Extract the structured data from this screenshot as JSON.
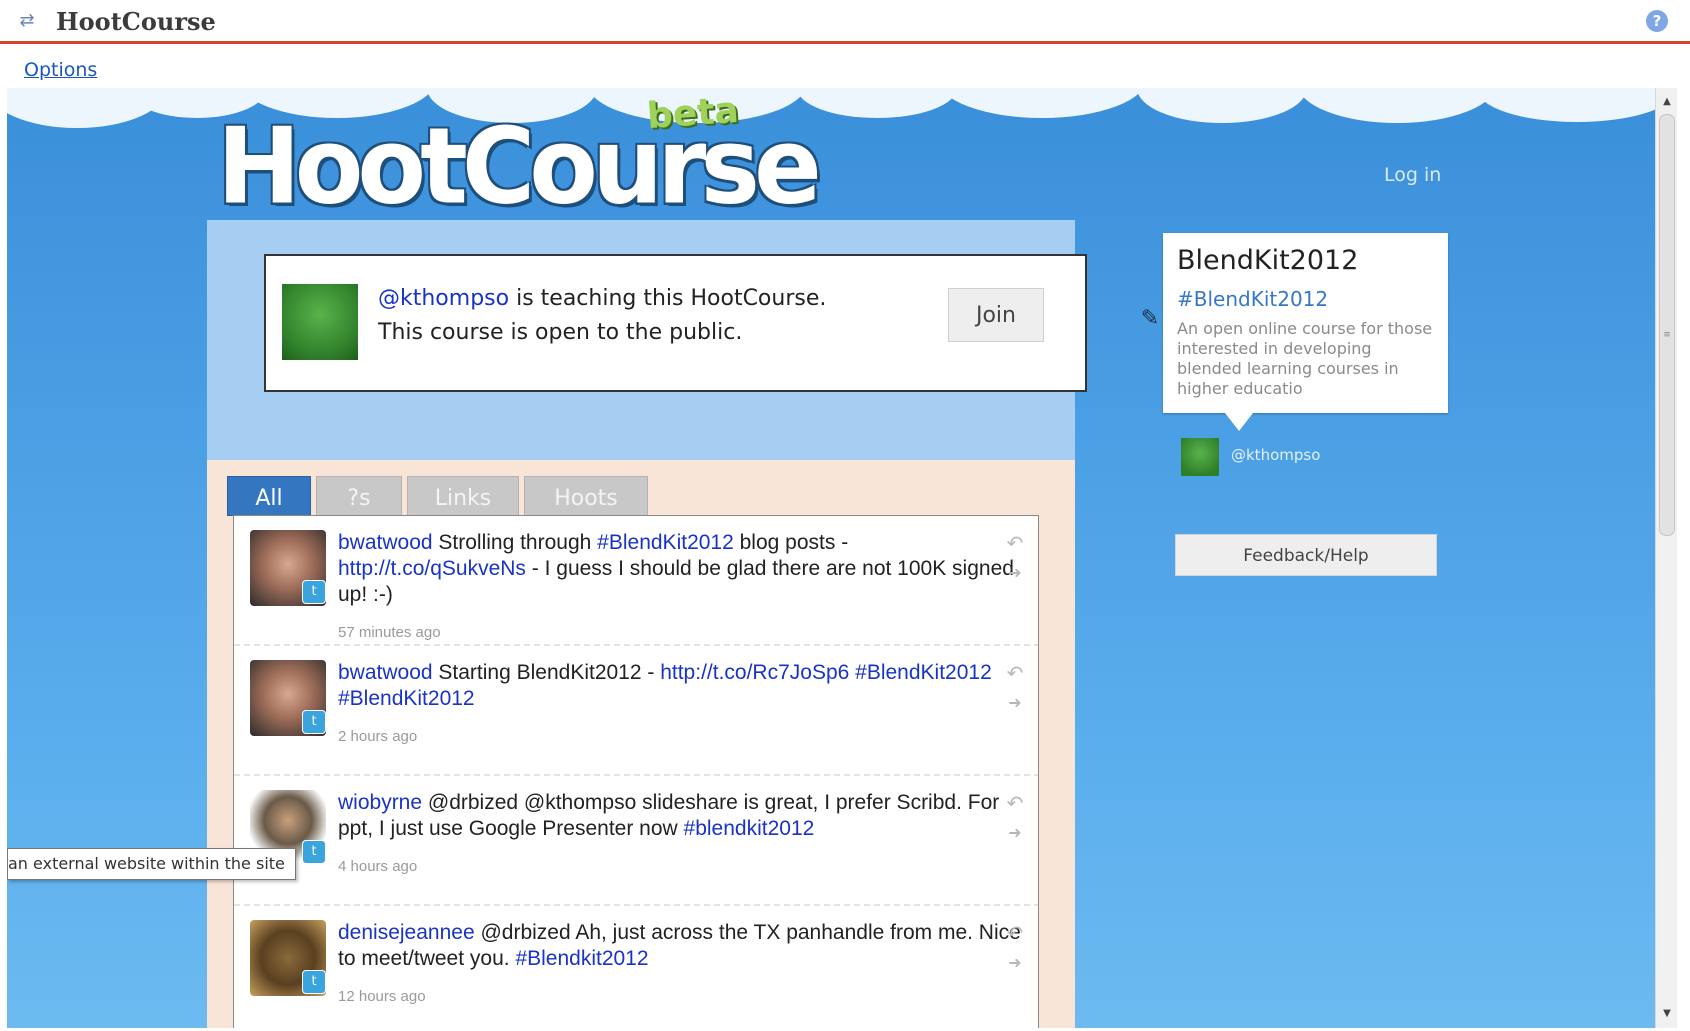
{
  "window": {
    "title": "HootCourse",
    "menu": {
      "options": "Options"
    }
  },
  "site": {
    "logo_text": "HootCourse",
    "logo_badge": "beta",
    "login": "Log in"
  },
  "teacher": {
    "handle": "@kthompso",
    "line1_suffix": " is teaching this HootCourse.",
    "line2": "This course is open to the public.",
    "join_label": "Join"
  },
  "tabs": [
    {
      "label": "All",
      "active": true
    },
    {
      "label": "?s",
      "active": false
    },
    {
      "label": "Links",
      "active": false
    },
    {
      "label": "Hoots",
      "active": false
    }
  ],
  "tweets": [
    {
      "user": "bwatwood",
      "time": "57 minutes ago",
      "parts": [
        {
          "t": "bwatwood",
          "link": true
        },
        {
          "t": " Strolling through ",
          "link": false
        },
        {
          "t": "#BlendKit2012",
          "link": true
        },
        {
          "t": " blog posts - ",
          "link": false
        },
        {
          "t": "http://t.co/qSukveNs",
          "link": true
        },
        {
          "t": " - I guess I should be glad there are not 100K signed up! :-)",
          "link": false
        }
      ]
    },
    {
      "user": "bwatwood",
      "time": "2 hours ago",
      "parts": [
        {
          "t": "bwatwood",
          "link": true
        },
        {
          "t": " Starting BlendKit2012 - ",
          "link": false
        },
        {
          "t": "http://t.co/Rc7JoSp6",
          "link": true
        },
        {
          "t": " ",
          "link": false
        },
        {
          "t": "#BlendKit2012",
          "link": true
        },
        {
          "t": " ",
          "link": false
        },
        {
          "t": "#BlendKit2012",
          "link": true
        }
      ]
    },
    {
      "user": "wiobyrne",
      "time": "4 hours ago",
      "parts": [
        {
          "t": "wiobyrne",
          "link": true
        },
        {
          "t": " @drbized @kthompso slideshare is great, I prefer Scribd. For ppt, I just use Google Presenter now ",
          "link": false
        },
        {
          "t": "#blendkit2012",
          "link": true
        }
      ]
    },
    {
      "user": "denisejeannee",
      "time": "12 hours ago",
      "parts": [
        {
          "t": "denisejeannee",
          "link": true
        },
        {
          "t": " @drbized Ah, just across the TX panhandle from me. Nice to meet/tweet you. ",
          "link": false
        },
        {
          "t": "#Blendkit2012",
          "link": true
        }
      ]
    }
  ],
  "course": {
    "title": "BlendKit2012",
    "hashtag": "#BlendKit2012",
    "description": "An open online course for those interested in developing blended learning courses in higher educatio",
    "owner": "@kthompso",
    "feedback": "Feedback/Help"
  },
  "tooltip": "an external website within the site",
  "icons": {
    "app": "arrows-icon",
    "help": "help-icon",
    "reply": "reply-icon",
    "retweet": "retweet-icon",
    "twitter": "twitter-icon",
    "edit": "pencil-icon"
  },
  "colors": {
    "accent_red": "#d0442a",
    "link_blue": "#1a33c7",
    "tab_active": "#3476c0",
    "sky": "#4a9ee3"
  }
}
